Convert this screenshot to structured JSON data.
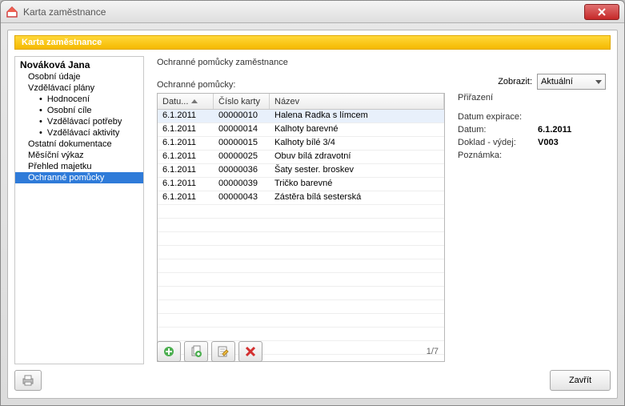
{
  "window": {
    "title": "Karta zaměstnance"
  },
  "orange": "Karta zaměstnance",
  "tree": {
    "root": "Nováková Jana",
    "items": [
      {
        "label": "Osobní údaje",
        "level": 1
      },
      {
        "label": "Vzdělávací plány",
        "level": 1
      },
      {
        "label": "Hodnocení",
        "level": 2
      },
      {
        "label": "Osobní cíle",
        "level": 2
      },
      {
        "label": "Vzdělávací potřeby",
        "level": 2
      },
      {
        "label": "Vzdělávací aktivity",
        "level": 2
      },
      {
        "label": "Ostatní dokumentace",
        "level": 1
      },
      {
        "label": "Měsíční výkaz",
        "level": 1
      },
      {
        "label": "Přehled majetku",
        "level": 1
      },
      {
        "label": "Ochranné pomůcky",
        "level": 1,
        "selected": true
      }
    ]
  },
  "main": {
    "title": "Ochranné pomůcky zaměstnance",
    "zobrazit_label": "Zobrazit:",
    "zobrazit_value": "Aktuální",
    "subtitle": "Ochranné pomůcky:",
    "columns": {
      "date": "Datu...",
      "card": "Číslo karty",
      "name": "Název"
    },
    "rows": [
      {
        "date": "6.1.2011",
        "card": "00000010",
        "name": "Halena Radka s límcem",
        "selected": true
      },
      {
        "date": "6.1.2011",
        "card": "00000014",
        "name": "Kalhoty barevné"
      },
      {
        "date": "6.1.2011",
        "card": "00000015",
        "name": "Kalhoty bílé 3/4"
      },
      {
        "date": "6.1.2011",
        "card": "00000025",
        "name": "Obuv bílá zdravotní"
      },
      {
        "date": "6.1.2011",
        "card": "00000036",
        "name": "Šaty sester. broskev"
      },
      {
        "date": "6.1.2011",
        "card": "00000039",
        "name": "Tričko barevné"
      },
      {
        "date": "6.1.2011",
        "card": "00000043",
        "name": "Zástěra bílá sesterská"
      }
    ],
    "pager": "1/7"
  },
  "detail": {
    "title": "Přiřazení",
    "rows": [
      {
        "label": "Datum expirace:",
        "value": ""
      },
      {
        "label": "Datum:",
        "value": "6.1.2011"
      },
      {
        "label": "Doklad - výdej:",
        "value": "V003"
      },
      {
        "label": "Poznámka:",
        "value": ""
      }
    ]
  },
  "footer": {
    "close": "Zavřít"
  },
  "icons": {
    "add": "add-icon",
    "add_copy": "add-copy-icon",
    "edit": "edit-icon",
    "delete": "delete-icon",
    "print": "print-icon"
  }
}
